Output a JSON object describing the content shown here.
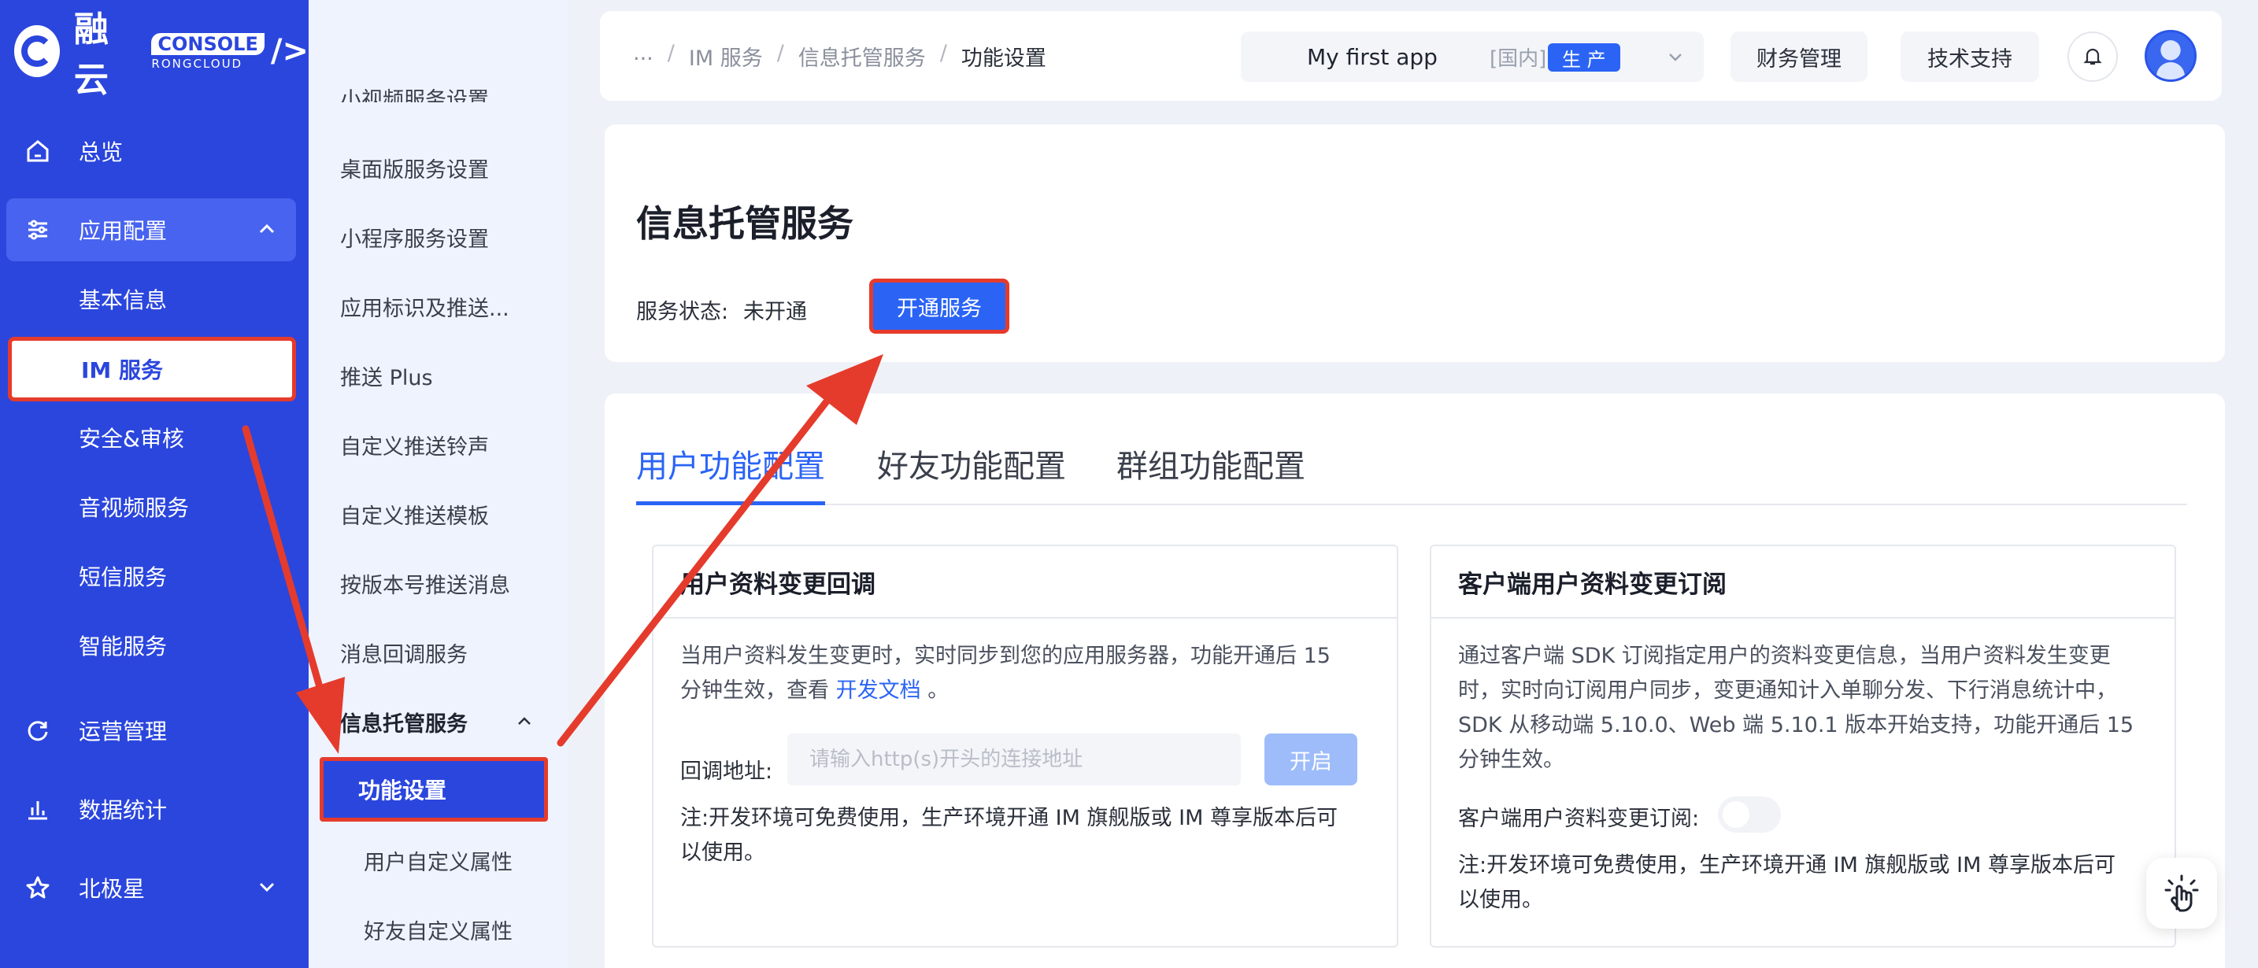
{
  "brand": {
    "name": "融云",
    "console_word": "CONSOLE",
    "console_sub": "RONGCLOUD",
    "slash": "/>"
  },
  "sidebar": {
    "items": [
      {
        "label": "总览",
        "icon": "home-icon"
      },
      {
        "label": "应用配置",
        "icon": "sliders-icon"
      },
      {
        "label": "运营管理",
        "icon": "refresh-icon"
      },
      {
        "label": "数据统计",
        "icon": "bar-chart-icon"
      },
      {
        "label": "北极星",
        "icon": "star-icon"
      }
    ],
    "app_config_children": [
      "基本信息",
      "IM 服务",
      "安全&审核",
      "音视频服务",
      "短信服务",
      "智能服务"
    ]
  },
  "subnav": {
    "items": [
      "小视频服务设置",
      "桌面版服务设置",
      "小程序服务设置",
      "应用标识及推送...",
      "推送 Plus",
      "自定义推送铃声",
      "自定义推送模板",
      "按版本号推送消息",
      "消息回调服务"
    ],
    "group_label": "信息托管服务",
    "selected": "功能设置",
    "children": [
      "用户自定义属性",
      "好友自定义属性"
    ]
  },
  "breadcrumb": [
    "...",
    "IM 服务",
    "信息托管服务",
    "功能设置"
  ],
  "app_select": {
    "name": "My first app",
    "region": "[国内]",
    "env": "生 产"
  },
  "top_buttons": {
    "finance": "财务管理",
    "support": "技术支持"
  },
  "service": {
    "title": "信息托管服务",
    "status_label": "服务状态:",
    "status_value": "未开通",
    "open_button": "开通服务"
  },
  "tabs": [
    "用户功能配置",
    "好友功能配置",
    "群组功能配置"
  ],
  "panel_left": {
    "title": "用户资料变更回调",
    "desc_prefix": "当用户资料发生变更时，实时同步到您的应用服务器，功能开通后 15 分钟生效，查看",
    "desc_link": "开发文档",
    "desc_suffix": "。",
    "callback_label": "回调地址:",
    "callback_placeholder": "请输入http(s)开头的连接地址",
    "callback_button": "开启",
    "note": "注:开发环境可免费使用，生产环境开通 IM 旗舰版或 IM 尊享版本后可以使用。"
  },
  "panel_right": {
    "title": "客户端用户资料变更订阅",
    "desc": "通过客户端 SDK 订阅指定用户的资料变更信息，当用户资料发生变更时，实时向订阅用户同步，变更通知计入单聊分发、下行消息统计中，SDK 从移动端 5.10.0、Web 端 5.10.1 版本开始支持，功能开通后 15 分钟生效。",
    "toggle_label": "客户端用户资料变更订阅:",
    "toggle_on": false,
    "note": "注:开发环境可免费使用，生产环境开通 IM 旗舰版或 IM 尊享版本后可以使用。"
  },
  "colors": {
    "brand_blue": "#2b46dd",
    "primary": "#2b64f5",
    "highlight_red": "#e53b2c"
  }
}
